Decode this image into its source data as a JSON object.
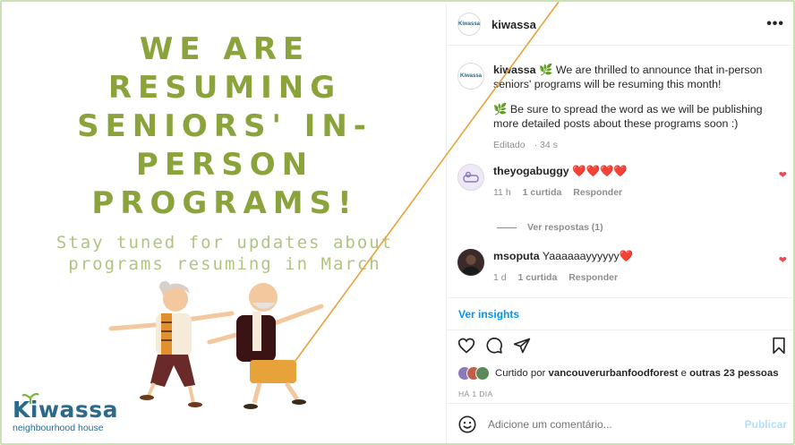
{
  "post_image": {
    "headline": [
      "WE ARE",
      "RESUMING",
      "SENIORS' IN-",
      "PERSON",
      "PROGRAMS!"
    ],
    "subline": [
      "Stay tuned for updates about",
      "programs resuming in March"
    ],
    "logo_name": "Kiwassa",
    "logo_sub": "neighbourhood house"
  },
  "header": {
    "username": "kiwassa",
    "more_label": "•••",
    "avatar_text": "Kiwassa"
  },
  "caption": {
    "username": "kiwassa",
    "line1": "🌿 We are thrilled to announce that in-person seniors' programs will be resuming this month!",
    "line2": "🌿 Be sure to spread the word as we will be publishing more detailed posts about these programs soon :)",
    "edited": "Editado",
    "time": "34 s"
  },
  "comments": [
    {
      "username": "theyogabuggy",
      "text": "❤️❤️❤️❤️",
      "time": "11 h",
      "likes": "1 curtida",
      "reply": "Responder"
    },
    {
      "username": "msoputa",
      "text": "Yaaaaaayyyyyy❤️",
      "time": "1 d",
      "likes": "1 curtida",
      "reply": "Responder"
    }
  ],
  "view_replies": "Ver respostas (1)",
  "insights_label": "Ver insights",
  "likes_summary": {
    "prefix": "Curtido por",
    "user": "vancouverurbanfoodforest",
    "connector": "e",
    "others": "outras 23 pessoas"
  },
  "date_label": "HÁ 1 DIA",
  "add_comment": {
    "placeholder": "Adicione um comentário...",
    "publish": "Publicar"
  },
  "icons": [
    "heart-icon",
    "comment-icon",
    "share-icon",
    "save-icon",
    "emoji-icon",
    "more-icon"
  ],
  "colors": {
    "accent": "#0095f6",
    "headline_green": "#8aa33a",
    "heart_red": "#ed4956",
    "logo_blue": "#2a6a8c",
    "annotation_line": "#e8a23a"
  }
}
